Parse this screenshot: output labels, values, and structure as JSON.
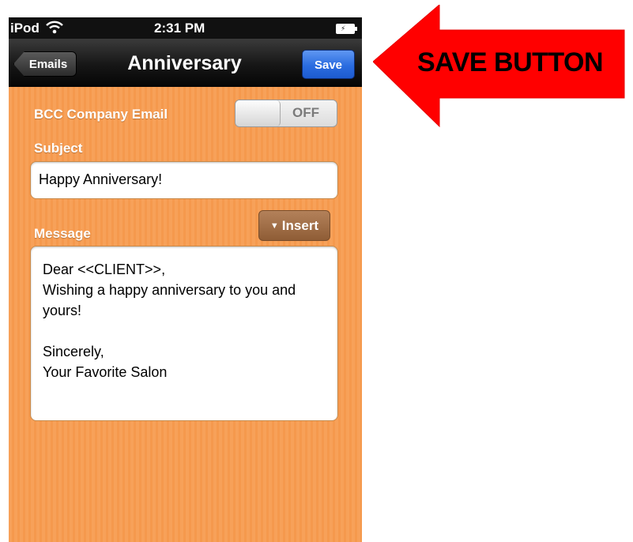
{
  "status_bar": {
    "carrier": "iPod",
    "time": "2:31 PM"
  },
  "nav": {
    "back_label": "Emails",
    "title": "Anniversary",
    "save_label": "Save"
  },
  "form": {
    "bcc_label": "BCC Company Email",
    "bcc_toggle_state": "OFF",
    "subject_label": "Subject",
    "subject_value": "Happy Anniversary!",
    "message_label": "Message",
    "insert_label": "Insert",
    "message_lines": [
      "Dear <<CLIENT>>,",
      "Wishing a happy anniversary to you and",
      "yours!",
      "",
      "Sincerely,",
      "Your Favorite Salon"
    ]
  },
  "annotation": {
    "text": "SAVE BUTTON",
    "arrow_color": "#ff0000"
  },
  "colors": {
    "background_orange": "#f7a159",
    "save_blue": "#2a6ce0",
    "insert_brown": "#9a673f"
  }
}
